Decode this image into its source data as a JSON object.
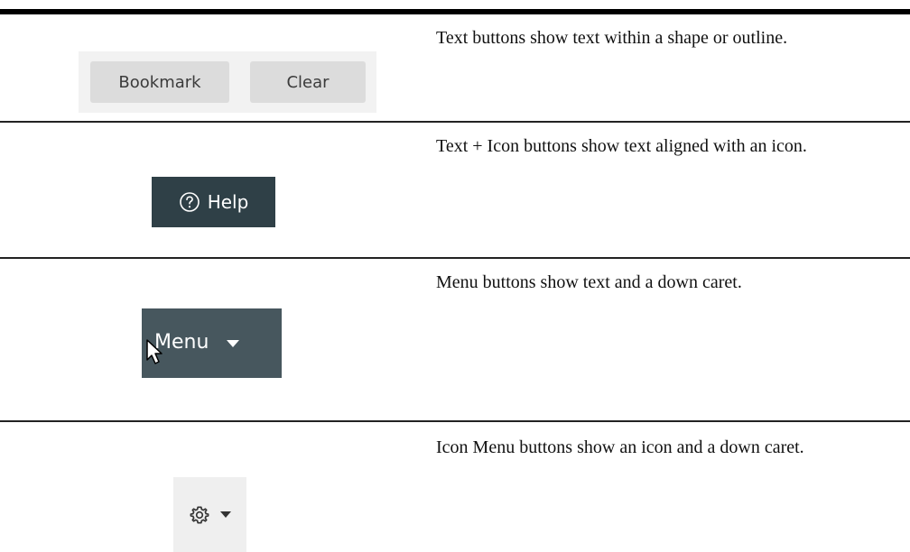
{
  "rows": [
    {
      "buttons": [
        {
          "label": "Bookmark"
        },
        {
          "label": "Clear"
        }
      ],
      "description": "Text buttons show text within a shape or outline."
    },
    {
      "button": {
        "label": "Help",
        "icon": "help-circle-icon"
      },
      "description": "Text + Icon buttons show text aligned with an icon."
    },
    {
      "button": {
        "label": "Menu",
        "icon": "caret-down-icon"
      },
      "description": "Menu buttons show text and a down caret."
    },
    {
      "button": {
        "icon": "gear-icon",
        "caret": "caret-down-icon"
      },
      "description": "Icon Menu buttons show an icon and a down caret."
    }
  ],
  "colors": {
    "help_button_bg": "#2f4047",
    "menu_button_bg": "#47575e",
    "text_button_bg": "#dcdcdc",
    "panel_bg": "#f2f2f2"
  }
}
